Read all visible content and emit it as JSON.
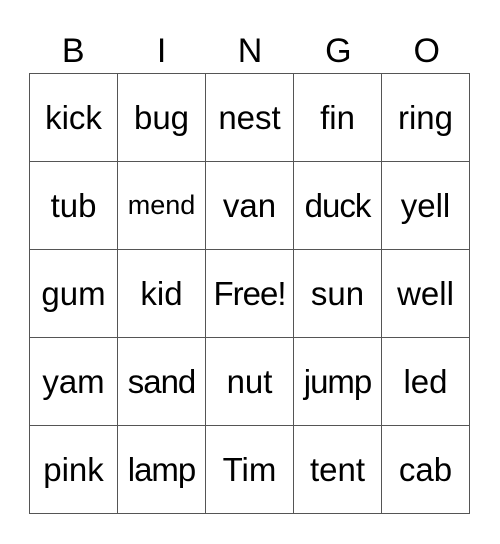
{
  "header": {
    "letters": [
      "B",
      "I",
      "N",
      "G",
      "O"
    ]
  },
  "grid": {
    "rows": [
      [
        "kick",
        "bug",
        "nest",
        "fin",
        "ring"
      ],
      [
        "tub",
        "mend",
        "van",
        "duck",
        "yell"
      ],
      [
        "gum",
        "kid",
        "Free!",
        "sun",
        "well"
      ],
      [
        "yam",
        "sand",
        "nut",
        "jump",
        "led"
      ],
      [
        "pink",
        "lamp",
        "Tim",
        "tent",
        "cab"
      ]
    ]
  }
}
